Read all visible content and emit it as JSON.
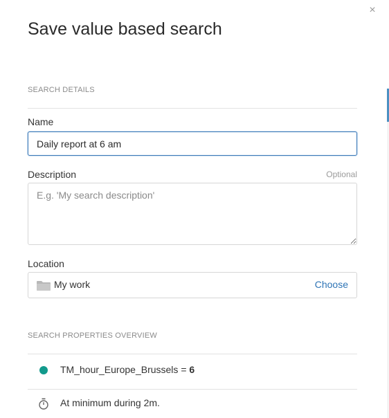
{
  "dialog": {
    "title": "Save value based search",
    "close_glyph": "×"
  },
  "search_details": {
    "heading": "SEARCH DETAILS",
    "name": {
      "label": "Name",
      "value": "Daily report at 6 am"
    },
    "description": {
      "label": "Description",
      "optional_label": "Optional",
      "placeholder": "E.g. 'My search description'",
      "value": ""
    },
    "location": {
      "label": "Location",
      "icon": "folder-icon",
      "value": "My work",
      "choose_label": "Choose"
    }
  },
  "properties_overview": {
    "heading": "SEARCH PROPERTIES OVERVIEW",
    "condition": {
      "tag": "TM_hour_Europe_Brussels",
      "operator": "=",
      "value": "6",
      "dot_color": "#129a8c"
    },
    "duration": {
      "icon": "timer-icon",
      "text": "At minimum during 2m."
    }
  },
  "colors": {
    "accent": "#3d7ab8",
    "link": "#2e74b5",
    "status_teal": "#129a8c"
  }
}
